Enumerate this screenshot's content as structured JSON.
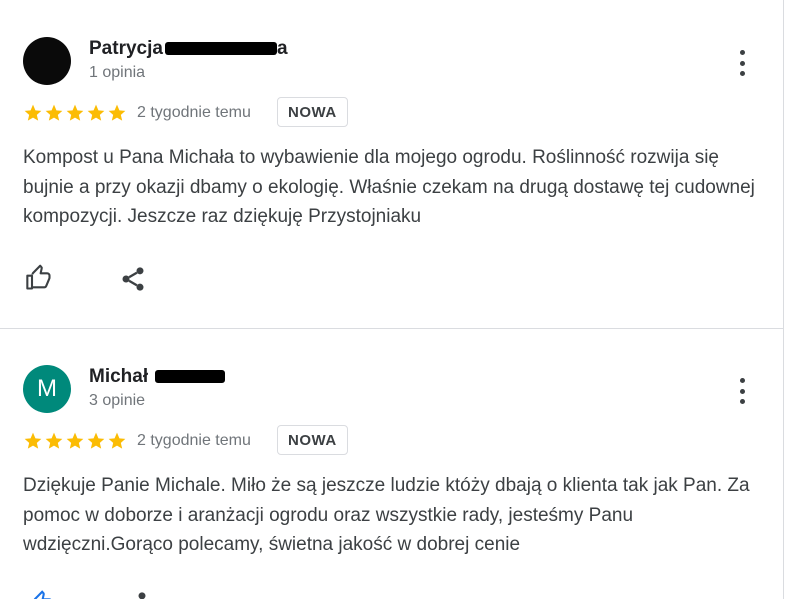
{
  "reviews": [
    {
      "author": "Patrycja",
      "author_suffix": "a",
      "review_count": "1 opinia",
      "rating": 5,
      "date": "2 tygodnie temu",
      "badge": "NOWA",
      "text": "Kompost u Pana Michała to wybawienie dla mojego ogrodu. Roślinność rozwija się bujnie a przy okazji dbamy o ekologię. Właśnie czekam na drugą dostawę tej cudownej kompozycji. Jeszcze raz dziękuję Przystojniaku",
      "avatar_color": "#0a0a0a",
      "avatar_letter": ""
    },
    {
      "author": "Michał",
      "author_suffix": "",
      "review_count": "3 opinie",
      "rating": 5,
      "date": "2 tygodnie temu",
      "badge": "NOWA",
      "text": "Dziękuje Panie Michale. Miło że są jeszcze ludzie któży dbają o klienta tak jak Pan. Za pomoc w doborze i aranżacji ogrodu oraz wszystkie rady, jesteśmy Panu wdzięczni.Gorąco polecamy, świetna jakość w dobrej cenie",
      "avatar_color": "#00897b",
      "avatar_letter": "M"
    }
  ],
  "colors": {
    "star": "#fbbc04",
    "icon": "#5f6368",
    "accent_partial": "#1a73e8"
  },
  "icons": {
    "like": "thumb-up-outline-icon",
    "share": "share-icon",
    "menu": "more-vert-icon",
    "star": "star-icon"
  }
}
